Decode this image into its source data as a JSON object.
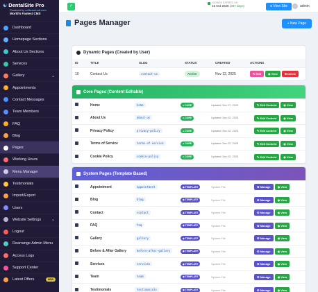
{
  "brand": {
    "title": "DentalSite Pro",
    "powered": "Powered by ",
    "powered_link": "softwarehub.com",
    "tagline": "World's Fastest CMS"
  },
  "sidebar": {
    "items": [
      {
        "label": "Dashboard",
        "icon": "dashboard-icon",
        "color": "#4aa3ff"
      },
      {
        "label": "Homepage Sections",
        "icon": "layers-icon",
        "color": "#5fb0ff"
      },
      {
        "label": "About Us Sections",
        "icon": "info-icon",
        "color": "#3cc9c9"
      },
      {
        "label": "Services",
        "icon": "tooth-icon",
        "color": "#37c6a8"
      },
      {
        "label": "Gallery",
        "icon": "image-icon",
        "color": "#ff7a59",
        "chevron": true
      },
      {
        "label": "Appointments",
        "icon": "calendar-icon",
        "color": "#ffb020"
      },
      {
        "label": "Contact Messages",
        "icon": "envelope-icon",
        "color": "#4a90ff"
      },
      {
        "label": "Team Members",
        "icon": "users-icon",
        "color": "#5a8dff"
      },
      {
        "label": "FAQ",
        "icon": "question-icon",
        "color": "#ffb020"
      },
      {
        "label": "Blog",
        "icon": "blog-icon",
        "color": "#ff9f43"
      },
      {
        "label": "Pages",
        "icon": "file-icon",
        "color": "#ffffff",
        "active": true
      },
      {
        "label": "Working Hours",
        "icon": "clock-icon",
        "color": "#ff6b6b"
      },
      {
        "label": "Menu Manager",
        "icon": "menu-icon",
        "color": "#d0cbe6",
        "highlight": true
      },
      {
        "label": "Testimonials",
        "icon": "star-icon",
        "color": "#ffc83d"
      },
      {
        "label": "Import/Export",
        "icon": "transfer-icon",
        "color": "#ff9f43"
      },
      {
        "label": "Users",
        "icon": "user-icon",
        "color": "#7f8cff"
      },
      {
        "label": "Website Settings",
        "icon": "gear-icon",
        "color": "#b9b4d0",
        "chevron": true
      },
      {
        "label": "Logout",
        "icon": "logout-icon",
        "color": "#ff5a5a"
      },
      {
        "label": "Rearrange Admin Menu",
        "icon": "rearrange-icon",
        "color": "#4ecdc4"
      },
      {
        "label": "Access Logs",
        "icon": "lock-icon",
        "color": "#ff6b6b"
      },
      {
        "label": "Support Center",
        "icon": "support-icon",
        "color": "#ff4fa3"
      },
      {
        "label": "Latest Offers",
        "icon": "offer-icon",
        "color": "#ff9f43",
        "badge": "NEW"
      }
    ]
  },
  "topbar": {
    "expiry_label": "LICENSE EXPIRES ON",
    "expiry_date": "15 Oct 2026",
    "expiry_days": "(387 days)",
    "view_site": "View Site",
    "user": "admin"
  },
  "main": {
    "title": "Pages Manager",
    "new_page": "+ New Page"
  },
  "dynamic": {
    "title": "Dynamic Pages (Created by User)",
    "headers": [
      "ID",
      "TITLE",
      "SLUG",
      "STATUS",
      "CREATED",
      "ACTIONS"
    ],
    "rows": [
      {
        "id": "10",
        "title": "Contact Us",
        "slug": "contact-us",
        "status": "Active",
        "created": "Nov 12, 2025"
      }
    ],
    "actions": {
      "edit": "Edit",
      "view": "View",
      "delete": "Delete"
    }
  },
  "core": {
    "title": "Core Pages (Content Editable)",
    "badge": "CORE",
    "edit_content": "Edit Content",
    "view": "View",
    "rows": [
      {
        "name": "Home",
        "slug": "home",
        "updated": "Updated: Dec 07, 2025",
        "icon": "home-icon"
      },
      {
        "name": "About Us",
        "slug": "about-us",
        "updated": "Updated: Dec 02, 2025",
        "icon": "info-icon"
      },
      {
        "name": "Privacy Policy",
        "slug": "privacy-policy",
        "updated": "Updated: Dec 02, 2025",
        "icon": "shield-icon"
      },
      {
        "name": "Terms of Service",
        "slug": "terms-of-service",
        "updated": "Updated: Dec 02, 2025",
        "icon": "doc-icon"
      },
      {
        "name": "Cookie Policy",
        "slug": "cookie-policy",
        "updated": "Updated: Dec 02, 2025",
        "icon": "cookie-icon"
      }
    ]
  },
  "system": {
    "title": "System Pages (Template Based)",
    "badge": "TEMPLATE",
    "sysfile": "System File",
    "manage": "Manage",
    "view": "View",
    "rows": [
      {
        "name": "Appointment",
        "slug": "appointment",
        "icon": "calendar-icon"
      },
      {
        "name": "Blog",
        "slug": "blog",
        "icon": "blog-icon"
      },
      {
        "name": "Contact",
        "slug": "contact",
        "icon": "envelope-icon"
      },
      {
        "name": "FAQ",
        "slug": "faq",
        "icon": "question-icon"
      },
      {
        "name": "Gallery",
        "slug": "gallery",
        "icon": "image-icon"
      },
      {
        "name": "Before & After Gallery",
        "slug": "before-after-gallery",
        "icon": "compare-icon"
      },
      {
        "name": "Services",
        "slug": "services",
        "icon": "tooth-icon"
      },
      {
        "name": "Team",
        "slug": "team",
        "icon": "users-icon"
      },
      {
        "name": "Testimonials",
        "slug": "testimonials",
        "icon": "star-icon"
      }
    ]
  }
}
